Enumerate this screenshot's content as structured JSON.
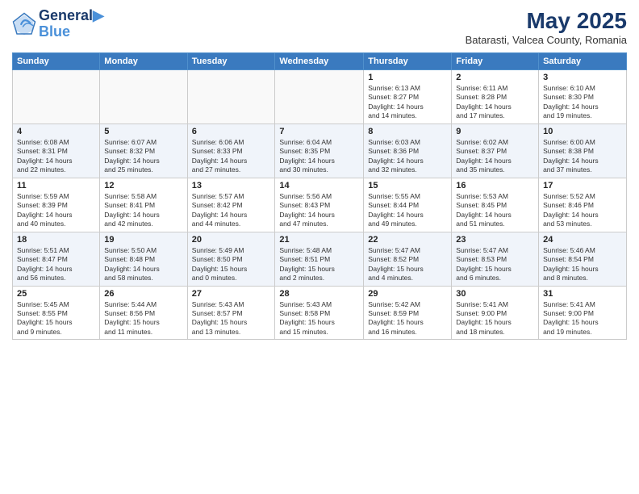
{
  "header": {
    "logo_line1": "General",
    "logo_line2": "Blue",
    "month_year": "May 2025",
    "location": "Batarasti, Valcea County, Romania"
  },
  "days_of_week": [
    "Sunday",
    "Monday",
    "Tuesday",
    "Wednesday",
    "Thursday",
    "Friday",
    "Saturday"
  ],
  "weeks": [
    [
      {
        "day": "",
        "info": ""
      },
      {
        "day": "",
        "info": ""
      },
      {
        "day": "",
        "info": ""
      },
      {
        "day": "",
        "info": ""
      },
      {
        "day": "1",
        "info": "Sunrise: 6:13 AM\nSunset: 8:27 PM\nDaylight: 14 hours\nand 14 minutes."
      },
      {
        "day": "2",
        "info": "Sunrise: 6:11 AM\nSunset: 8:28 PM\nDaylight: 14 hours\nand 17 minutes."
      },
      {
        "day": "3",
        "info": "Sunrise: 6:10 AM\nSunset: 8:30 PM\nDaylight: 14 hours\nand 19 minutes."
      }
    ],
    [
      {
        "day": "4",
        "info": "Sunrise: 6:08 AM\nSunset: 8:31 PM\nDaylight: 14 hours\nand 22 minutes."
      },
      {
        "day": "5",
        "info": "Sunrise: 6:07 AM\nSunset: 8:32 PM\nDaylight: 14 hours\nand 25 minutes."
      },
      {
        "day": "6",
        "info": "Sunrise: 6:06 AM\nSunset: 8:33 PM\nDaylight: 14 hours\nand 27 minutes."
      },
      {
        "day": "7",
        "info": "Sunrise: 6:04 AM\nSunset: 8:35 PM\nDaylight: 14 hours\nand 30 minutes."
      },
      {
        "day": "8",
        "info": "Sunrise: 6:03 AM\nSunset: 8:36 PM\nDaylight: 14 hours\nand 32 minutes."
      },
      {
        "day": "9",
        "info": "Sunrise: 6:02 AM\nSunset: 8:37 PM\nDaylight: 14 hours\nand 35 minutes."
      },
      {
        "day": "10",
        "info": "Sunrise: 6:00 AM\nSunset: 8:38 PM\nDaylight: 14 hours\nand 37 minutes."
      }
    ],
    [
      {
        "day": "11",
        "info": "Sunrise: 5:59 AM\nSunset: 8:39 PM\nDaylight: 14 hours\nand 40 minutes."
      },
      {
        "day": "12",
        "info": "Sunrise: 5:58 AM\nSunset: 8:41 PM\nDaylight: 14 hours\nand 42 minutes."
      },
      {
        "day": "13",
        "info": "Sunrise: 5:57 AM\nSunset: 8:42 PM\nDaylight: 14 hours\nand 44 minutes."
      },
      {
        "day": "14",
        "info": "Sunrise: 5:56 AM\nSunset: 8:43 PM\nDaylight: 14 hours\nand 47 minutes."
      },
      {
        "day": "15",
        "info": "Sunrise: 5:55 AM\nSunset: 8:44 PM\nDaylight: 14 hours\nand 49 minutes."
      },
      {
        "day": "16",
        "info": "Sunrise: 5:53 AM\nSunset: 8:45 PM\nDaylight: 14 hours\nand 51 minutes."
      },
      {
        "day": "17",
        "info": "Sunrise: 5:52 AM\nSunset: 8:46 PM\nDaylight: 14 hours\nand 53 minutes."
      }
    ],
    [
      {
        "day": "18",
        "info": "Sunrise: 5:51 AM\nSunset: 8:47 PM\nDaylight: 14 hours\nand 56 minutes."
      },
      {
        "day": "19",
        "info": "Sunrise: 5:50 AM\nSunset: 8:48 PM\nDaylight: 14 hours\nand 58 minutes."
      },
      {
        "day": "20",
        "info": "Sunrise: 5:49 AM\nSunset: 8:50 PM\nDaylight: 15 hours\nand 0 minutes."
      },
      {
        "day": "21",
        "info": "Sunrise: 5:48 AM\nSunset: 8:51 PM\nDaylight: 15 hours\nand 2 minutes."
      },
      {
        "day": "22",
        "info": "Sunrise: 5:47 AM\nSunset: 8:52 PM\nDaylight: 15 hours\nand 4 minutes."
      },
      {
        "day": "23",
        "info": "Sunrise: 5:47 AM\nSunset: 8:53 PM\nDaylight: 15 hours\nand 6 minutes."
      },
      {
        "day": "24",
        "info": "Sunrise: 5:46 AM\nSunset: 8:54 PM\nDaylight: 15 hours\nand 8 minutes."
      }
    ],
    [
      {
        "day": "25",
        "info": "Sunrise: 5:45 AM\nSunset: 8:55 PM\nDaylight: 15 hours\nand 9 minutes."
      },
      {
        "day": "26",
        "info": "Sunrise: 5:44 AM\nSunset: 8:56 PM\nDaylight: 15 hours\nand 11 minutes."
      },
      {
        "day": "27",
        "info": "Sunrise: 5:43 AM\nSunset: 8:57 PM\nDaylight: 15 hours\nand 13 minutes."
      },
      {
        "day": "28",
        "info": "Sunrise: 5:43 AM\nSunset: 8:58 PM\nDaylight: 15 hours\nand 15 minutes."
      },
      {
        "day": "29",
        "info": "Sunrise: 5:42 AM\nSunset: 8:59 PM\nDaylight: 15 hours\nand 16 minutes."
      },
      {
        "day": "30",
        "info": "Sunrise: 5:41 AM\nSunset: 9:00 PM\nDaylight: 15 hours\nand 18 minutes."
      },
      {
        "day": "31",
        "info": "Sunrise: 5:41 AM\nSunset: 9:00 PM\nDaylight: 15 hours\nand 19 minutes."
      }
    ]
  ]
}
